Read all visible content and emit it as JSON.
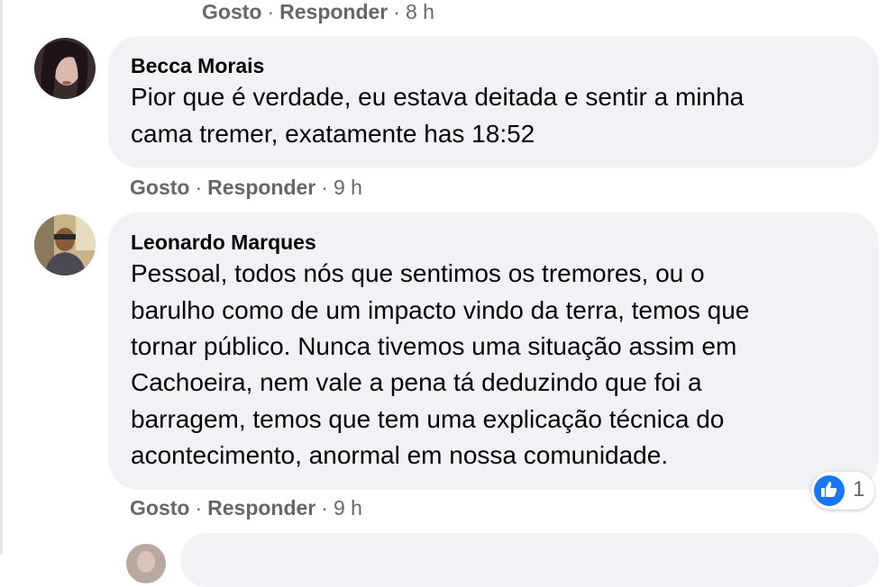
{
  "actions": {
    "like_label": "Gosto",
    "reply_label": "Responder",
    "separator": "·"
  },
  "comments": [
    {
      "time": "8 h"
    },
    {
      "author": "Becca Morais",
      "text_lines": [
        "Pior que é verdade, eu estava deitada e sentir a minha",
        "cama tremer, exatamente has 18:52"
      ],
      "time": "9 h"
    },
    {
      "author": "Leonardo Marques",
      "text_lines": [
        "Pessoal, todos nós que sentimos os tremores, ou o",
        "barulho como de um impacto vindo da terra, temos que",
        "tornar público. Nunca tivemos uma situação assim em",
        "Cachoeira, nem vale a pena tá deduzindo que foi a",
        "barragem, temos que tem uma explicação técnica do",
        "acontecimento, anormal em nossa comunidade."
      ],
      "time": "9 h",
      "reactions": {
        "icon": "like-icon",
        "count": "1",
        "color": "#1877f2"
      }
    }
  ],
  "colors": {
    "bubble": "#f0f2f5",
    "meta_text": "#65676b",
    "accent": "#1877f2"
  }
}
